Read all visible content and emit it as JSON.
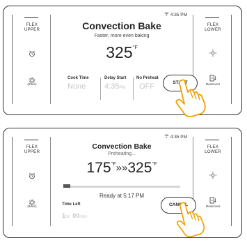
{
  "panel1": {
    "status": {
      "wifi_icon": "wifi-icon",
      "time": "4:35 PM"
    },
    "left": {
      "flex_label": "FLEX\nUPPER",
      "timer_icon": "alarm-clock-icon",
      "settings_icon": "gear-icon",
      "settings_label": "(3sec)"
    },
    "right": {
      "flex_label": "FLEX\nLOWER",
      "light_icon": "light-icon",
      "reservoir_icon": "reservoir-icon",
      "reservoir_label": "Reservoir"
    },
    "title": "Convection Bake",
    "subtitle": "Faster, more even baking",
    "temp": "325",
    "unit": "°F",
    "options": [
      {
        "label": "Cook Time",
        "value": "None",
        "suffix": ""
      },
      {
        "label": "Delay Start",
        "value": "4:35",
        "suffix": "PM"
      },
      {
        "label": "No Preheat",
        "value": "OFF",
        "suffix": ""
      }
    ],
    "start_label": "START"
  },
  "panel2": {
    "status": {
      "wifi_icon": "wifi-icon",
      "time": "4:35 PM"
    },
    "left": {
      "flex_label": "FLEX\nUPPER",
      "timer_icon": "alarm-clock-icon",
      "settings_icon": "gear-icon",
      "settings_label": "(3sec)"
    },
    "right": {
      "flex_label": "FLEX\nLOWER",
      "light_icon": "light-icon",
      "reservoir_icon": "reservoir-icon",
      "reservoir_label": "Reservoir"
    },
    "title": "Convection Bake",
    "subtitle": "Preheating...",
    "current_temp": "175",
    "target_temp": "325",
    "unit": "°F",
    "arrow": "»»",
    "progress_fraction": 0.06,
    "ready_text": "Ready at 5:17 PM",
    "time_left_label": "Time Left",
    "time_left_hours": "1",
    "time_left_hr_unit": "hr",
    "time_left_minutes": "00",
    "time_left_min_unit": "min",
    "cancel_label": "CANCEL"
  }
}
